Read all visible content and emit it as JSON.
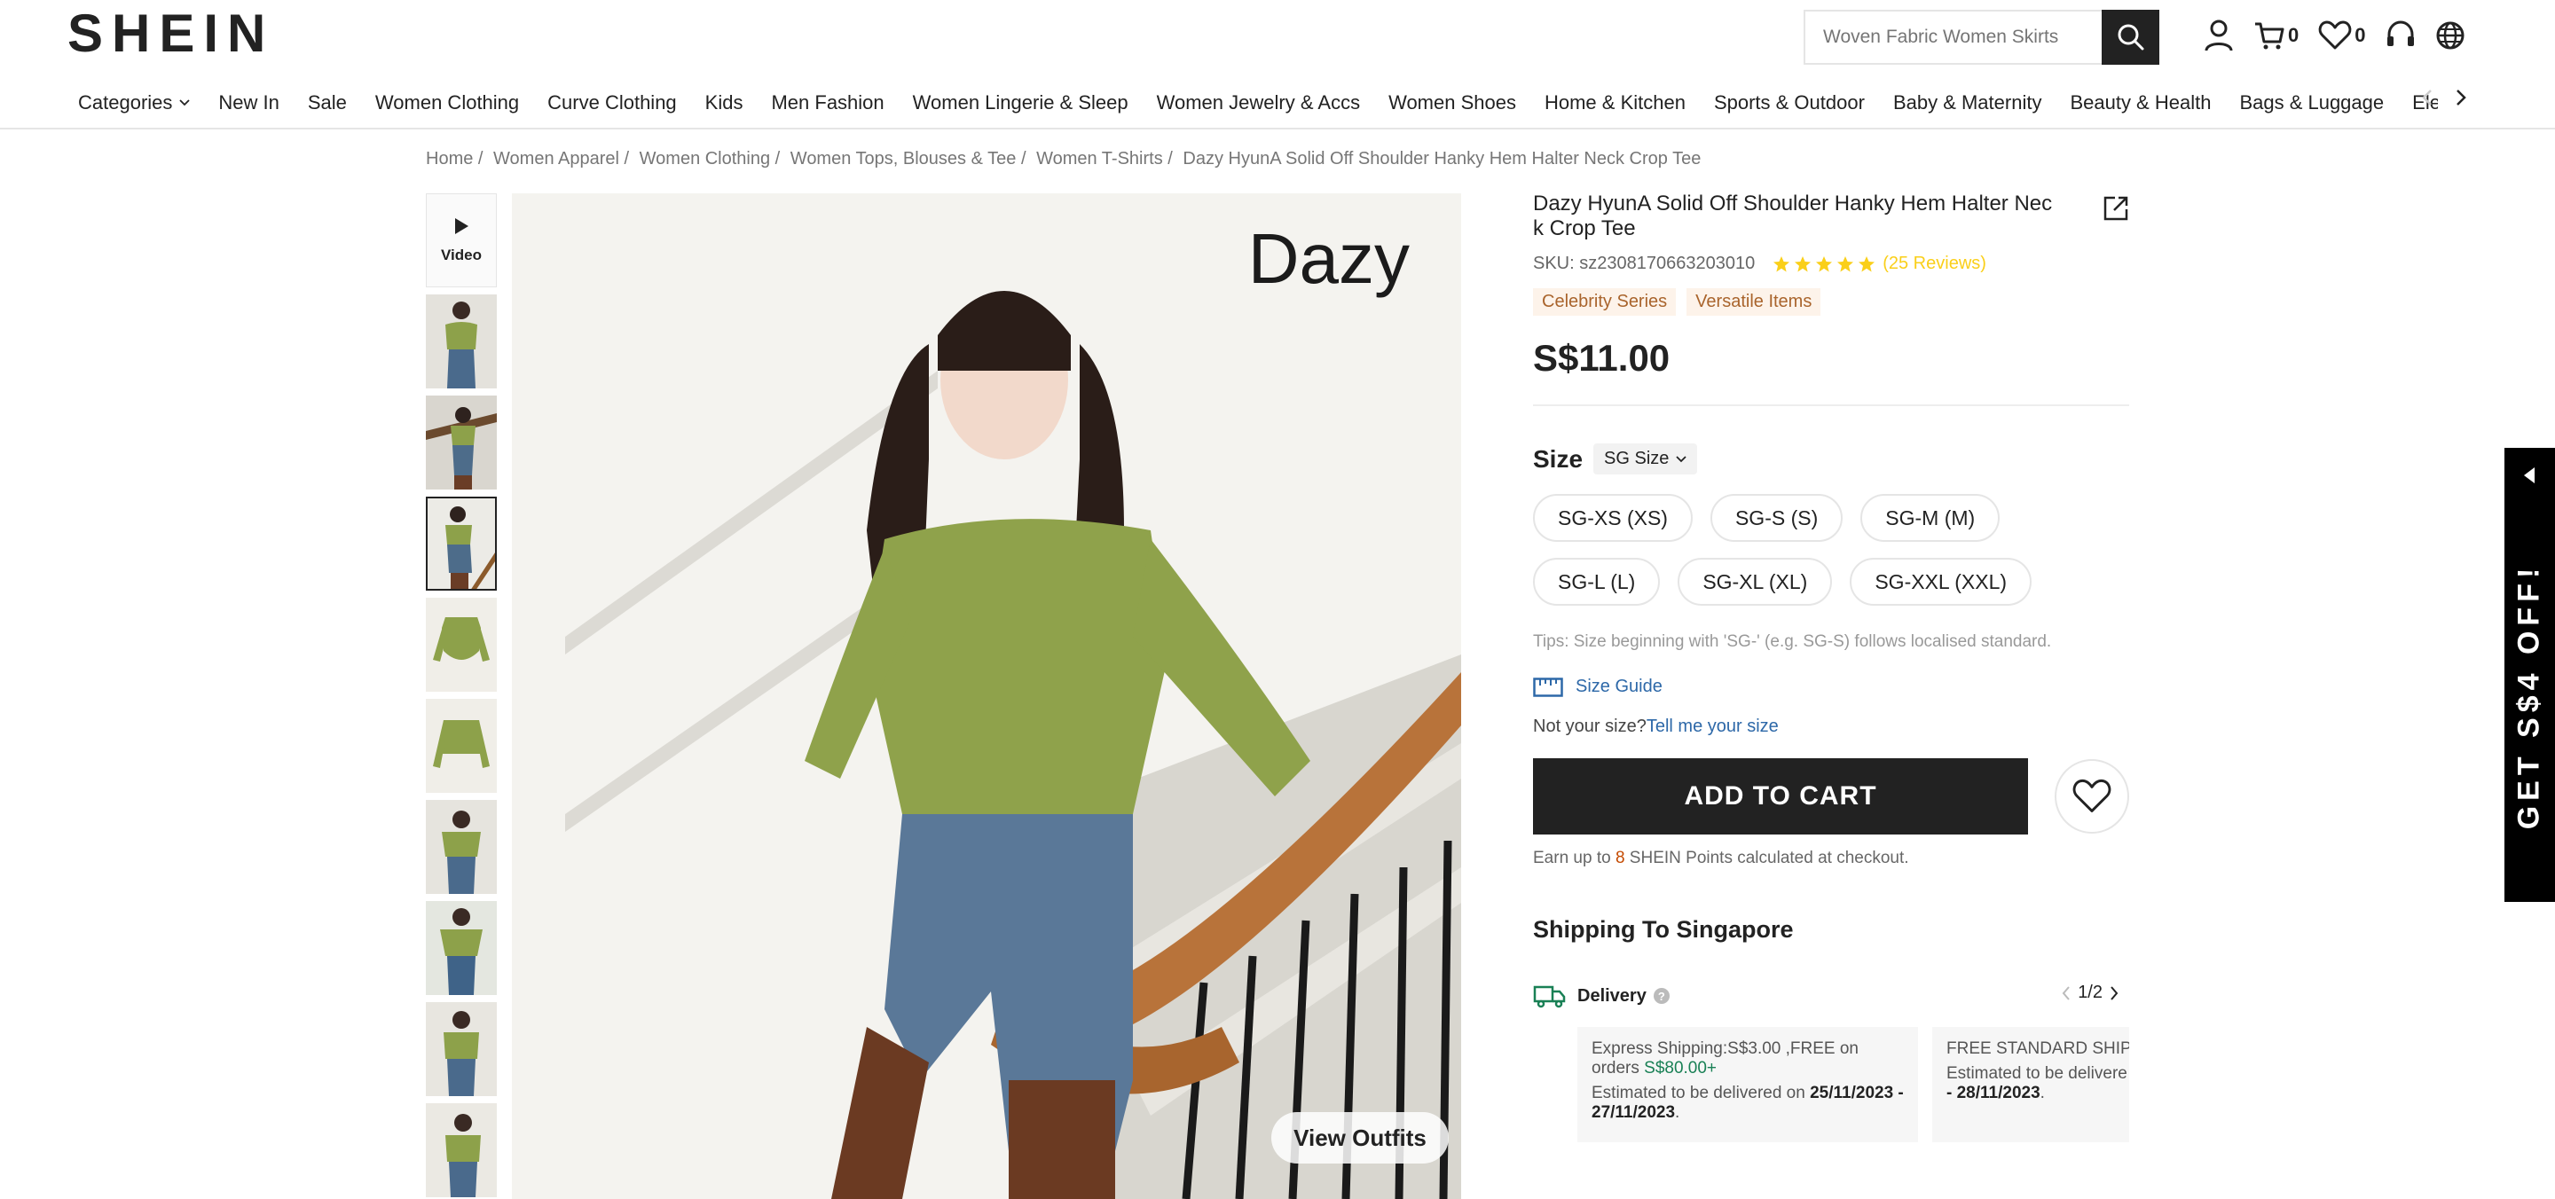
{
  "header": {
    "logo": "SHEIN",
    "search_placeholder": "Woven Fabric Women Skirts",
    "cart_count": "0",
    "wishlist_count": "0"
  },
  "nav": {
    "items": [
      {
        "label": "Categories"
      },
      {
        "label": "New In"
      },
      {
        "label": "Sale"
      },
      {
        "label": "Women Clothing"
      },
      {
        "label": "Curve Clothing"
      },
      {
        "label": "Kids"
      },
      {
        "label": "Men Fashion"
      },
      {
        "label": "Women Lingerie & Sleep"
      },
      {
        "label": "Women Jewelry & Accs"
      },
      {
        "label": "Women Shoes"
      },
      {
        "label": "Home & Kitchen"
      },
      {
        "label": "Sports & Outdoor"
      },
      {
        "label": "Baby & Maternity"
      },
      {
        "label": "Beauty & Health"
      },
      {
        "label": "Bags & Luggage"
      },
      {
        "label": "Elect"
      }
    ]
  },
  "breadcrumb": [
    "Home /",
    "Women Apparel /",
    "Women Clothing /",
    "Women Tops, Blouses & Tee /",
    "Women T-Shirts /",
    "Dazy HyunA Solid Off Shoulder Hanky Hem Halter Neck Crop Tee"
  ],
  "gallery": {
    "video_label": "Video",
    "brand_mark": "Dazy",
    "view_outfits": "View Outfits"
  },
  "product": {
    "title": "Dazy HyunA Solid Off Shoulder Hanky Hem Halter Neck Crop Tee",
    "sku": "SKU: sz2308170663203010",
    "rating": 5,
    "reviews": "(25 Reviews)",
    "tags": [
      "Celebrity Series",
      "Versatile Items"
    ],
    "price": "S$11.00",
    "size_label": "Size",
    "size_standard": "SG Size",
    "sizes": [
      "SG-XS (XS)",
      "SG-S (S)",
      "SG-M (M)",
      "SG-L (L)",
      "SG-XL (XL)",
      "SG-XXL (XXL)"
    ],
    "tips": "Tips: Size beginning with 'SG-' (e.g. SG-S) follows localised standard.",
    "size_guide": "Size Guide",
    "not_your_size": "Not your size?",
    "tell_me": "Tell me your size",
    "add_to_cart": "ADD TO CART",
    "points_pre": "Earn up to ",
    "points_num": "8",
    "points_post": " SHEIN Points calculated at checkout."
  },
  "shipping": {
    "title": "Shipping To Singapore",
    "delivery_label": "Delivery",
    "pager": "1/2",
    "card1": {
      "line1": "Express Shipping:S$3.00 ,FREE on orders ",
      "threshold": "S$80.00+",
      "est_pre": "Estimated to be delivered on ",
      "dates": "25/11/2023 - 27/11/2023",
      "est_post": "."
    },
    "card2": {
      "line1": "FREE STANDARD SHIP",
      "est_pre": "Estimated to be delivere",
      "dates": "- 28/11/2023",
      "est_post": "."
    }
  },
  "promo": {
    "text": "GET S$4 OFF!"
  }
}
